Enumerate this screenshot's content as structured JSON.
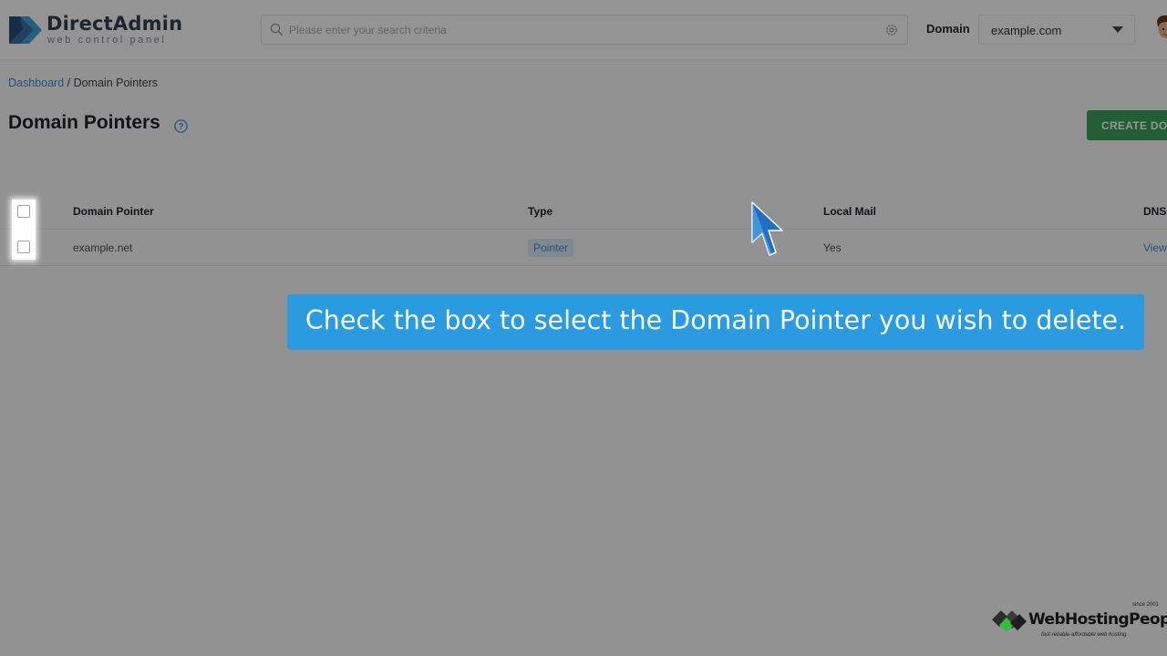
{
  "brand": {
    "name": "DirectAdmin",
    "subtitle": "web control panel"
  },
  "search": {
    "placeholder": "Please enter your search criteria"
  },
  "domain_selector": {
    "label": "Domain",
    "value": "example.com"
  },
  "breadcrumb": {
    "root": "Dashboard",
    "separator": " / ",
    "current": "Domain Pointers"
  },
  "page": {
    "title": "Domain Pointers",
    "create_button": "CREATE DOM"
  },
  "table": {
    "headers": {
      "pointer": "Domain Pointer",
      "type": "Type",
      "local_mail": "Local Mail",
      "dns": "DNS"
    },
    "rows": [
      {
        "pointer": "example.net",
        "type": "Pointer",
        "local_mail": "Yes",
        "dns": "View"
      }
    ]
  },
  "caption": "Check the box to select the Domain Pointer you wish to delete.",
  "watermark": {
    "name": "WebHostingPeople",
    "since": "since 2001",
    "tagline": "fast-reliable-affordable web hosting"
  },
  "colors": {
    "accent": "#3d8fd1",
    "create_button": "#3aa35a",
    "caption_bg": "#2a9be0"
  }
}
